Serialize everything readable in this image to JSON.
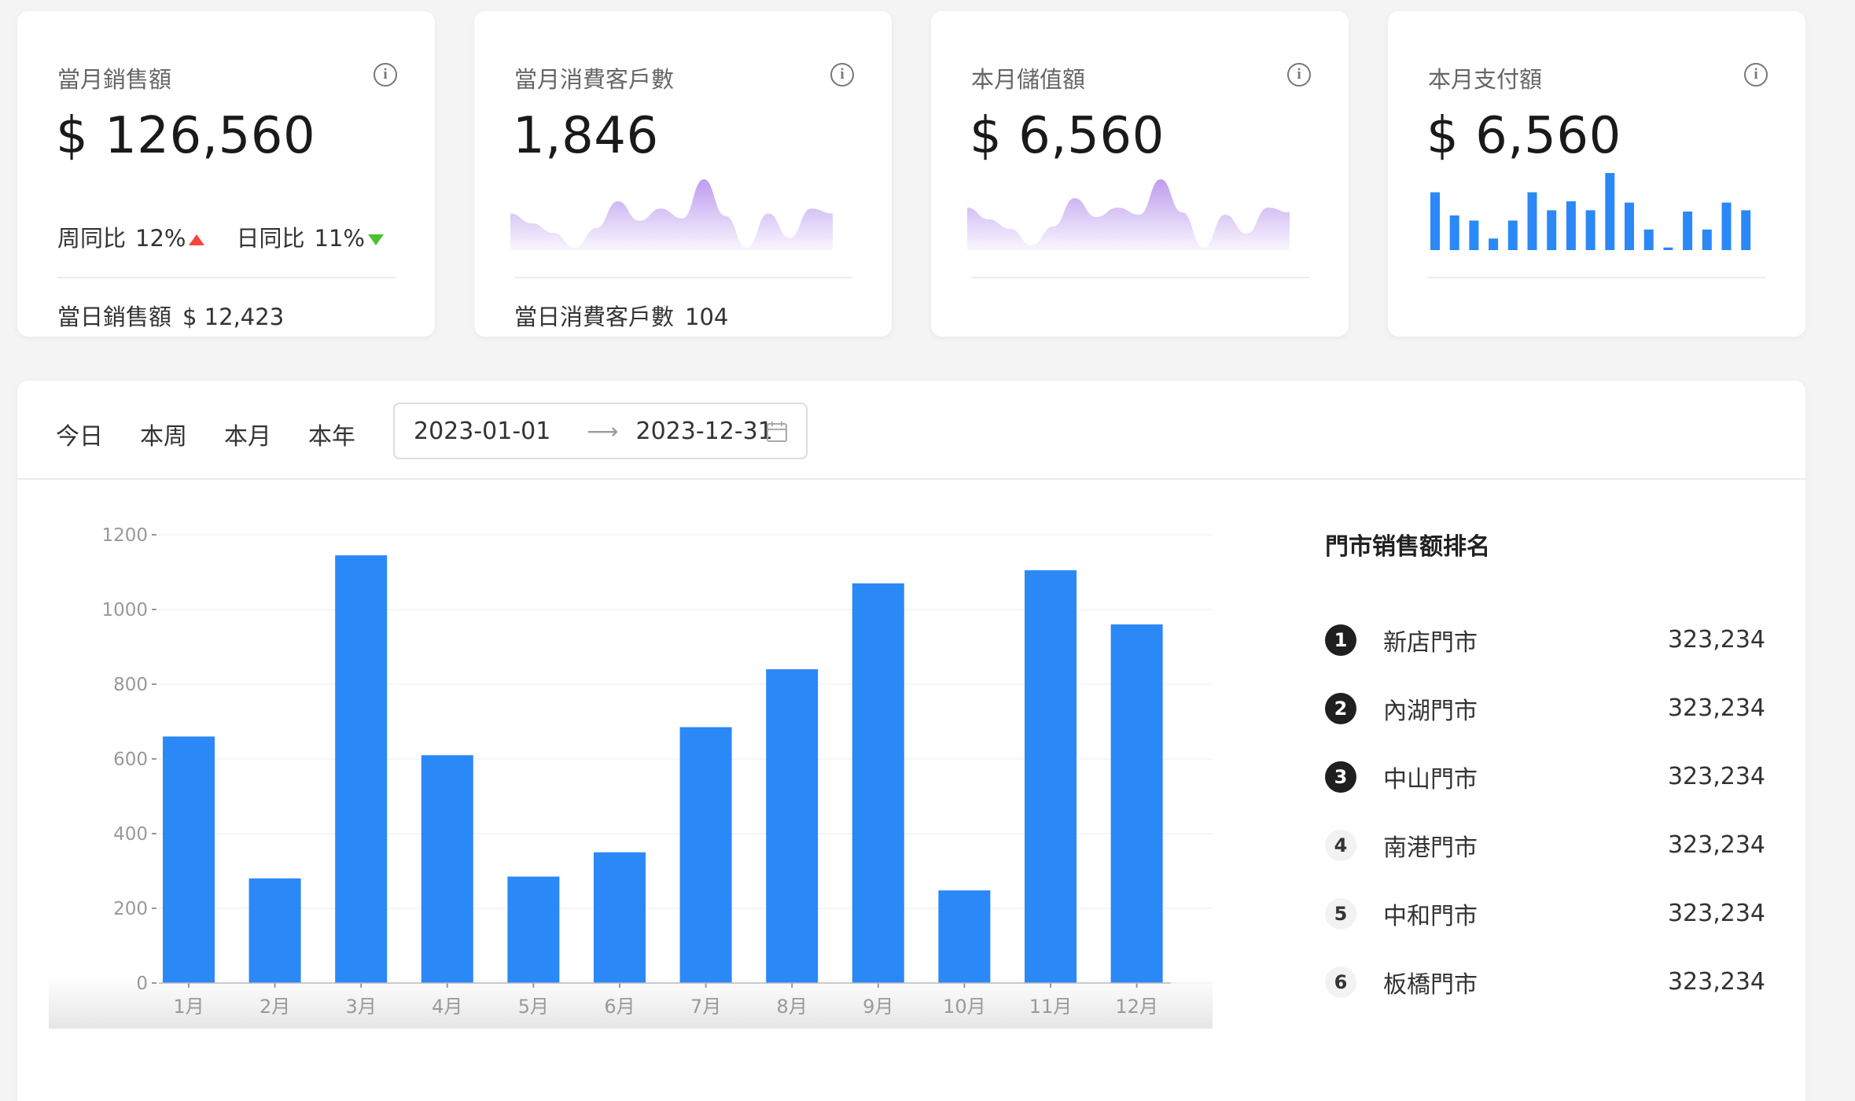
{
  "cards": [
    {
      "title": "當月銷售額",
      "value": "$ 126,560",
      "week_label": "周同比",
      "week_pct": "12%",
      "day_label": "日同比",
      "day_pct": "11%",
      "footer_label": "當日銷售額",
      "footer_value": "$ 12,423"
    },
    {
      "title": "當月消費客戶數",
      "value": "1,846",
      "footer_label": "當日消費客戶數",
      "footer_value": "104"
    },
    {
      "title": "本月儲值額",
      "value": "$ 6,560"
    },
    {
      "title": "本月支付額",
      "value": "$ 6,560"
    }
  ],
  "colors": {
    "bar": "#2b88f7",
    "up": "#f5463e",
    "down": "#4cc02e",
    "area": "#b28bec"
  },
  "tabs": [
    "今日",
    "本周",
    "本月",
    "本年"
  ],
  "daterange": {
    "start": "2023-01-01",
    "end": "2023-12-31"
  },
  "ranking": {
    "title": "門市销售额排名",
    "items": [
      {
        "rank": "1",
        "name": "新店門市",
        "value": "323,234"
      },
      {
        "rank": "2",
        "name": "內湖門市",
        "value": "323,234"
      },
      {
        "rank": "3",
        "name": "中山門市",
        "value": "323,234"
      },
      {
        "rank": "4",
        "name": "南港門市",
        "value": "323,234"
      },
      {
        "rank": "5",
        "name": "中和門市",
        "value": "323,234"
      },
      {
        "rank": "6",
        "name": "板橋門市",
        "value": "323,234"
      }
    ]
  },
  "chart_data": {
    "type": "bar",
    "categories": [
      "1月",
      "2月",
      "3月",
      "4月",
      "5月",
      "6月",
      "7月",
      "8月",
      "9月",
      "10月",
      "11月",
      "12月"
    ],
    "values": [
      660,
      280,
      1145,
      610,
      285,
      350,
      685,
      840,
      1070,
      248,
      1105,
      960
    ],
    "ylim": [
      0,
      1200
    ],
    "yticks": [
      0,
      200,
      400,
      600,
      800,
      1000,
      1200
    ],
    "grid": true,
    "title": "",
    "xlabel": "",
    "ylabel": ""
  },
  "sparklines": {
    "customers": [
      30,
      22,
      14,
      2,
      18,
      40,
      24,
      34,
      26,
      58,
      28,
      2,
      30,
      10,
      34,
      30
    ],
    "stored": [
      36,
      26,
      18,
      4,
      20,
      44,
      28,
      36,
      30,
      60,
      32,
      2,
      30,
      14,
      36,
      32
    ],
    "payments": [
      45,
      27,
      23,
      9,
      23,
      45,
      31,
      38,
      31,
      60,
      37,
      16,
      2,
      30,
      16,
      37,
      31
    ]
  }
}
